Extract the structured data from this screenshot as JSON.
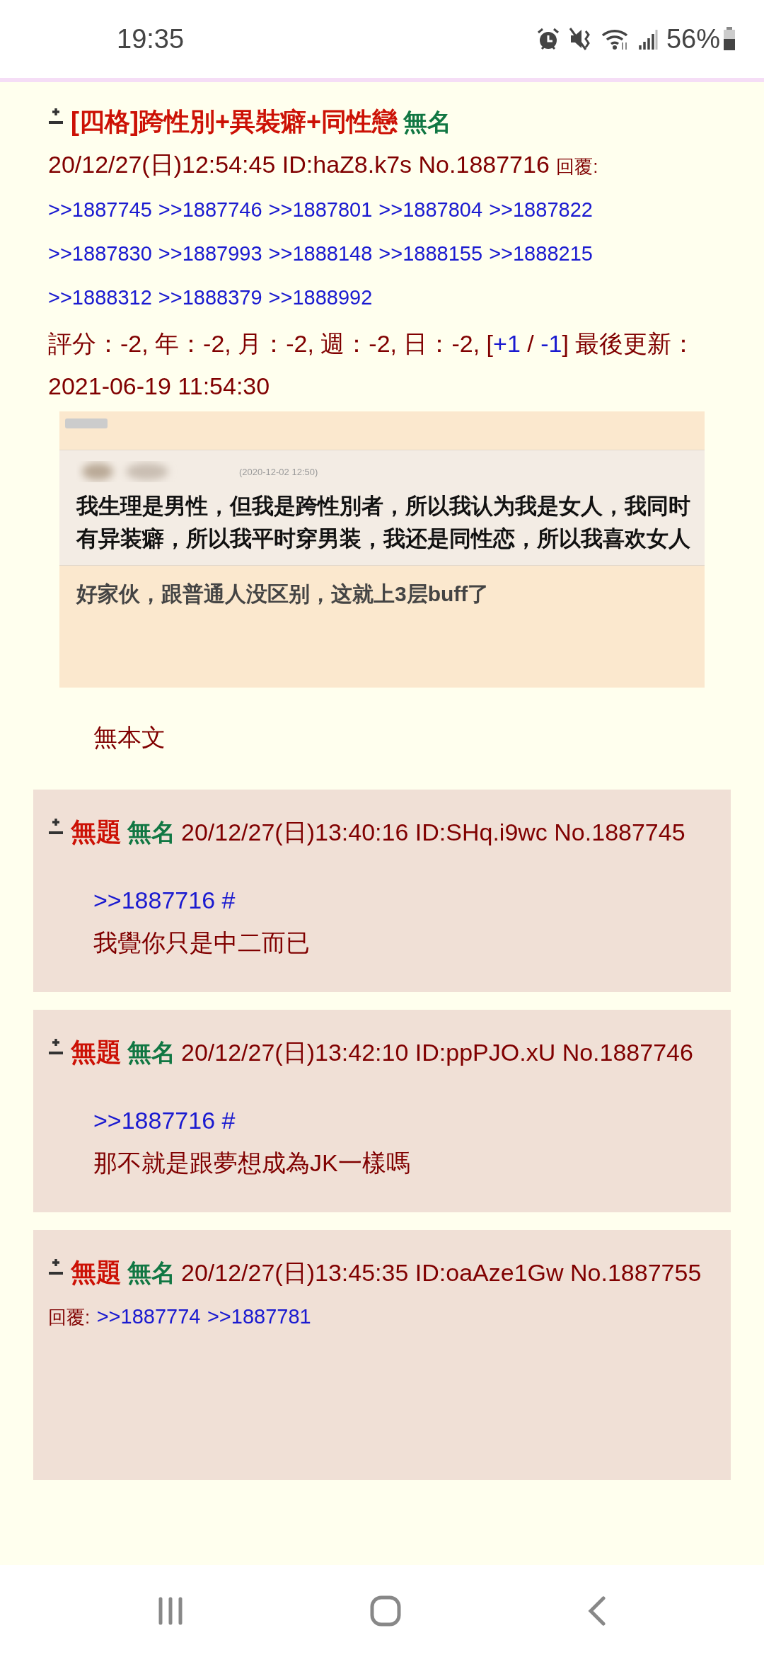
{
  "status_bar": {
    "time": "19:35",
    "battery": "56%"
  },
  "thread": {
    "title": "[四格]跨性別+異裝癖+同性戀",
    "name": "無名",
    "datetime": "20/12/27(日)12:54:45",
    "id": "ID:haZ8.k7s",
    "number": "No.1887716",
    "replies_label": "回覆:",
    "reply_links": [
      ">>1887745",
      ">>1887746",
      ">>1887801",
      ">>1887804",
      ">>1887822",
      ">>1887830",
      ">>1887993",
      ">>1888148",
      ">>1888155",
      ">>1888215",
      ">>1888312",
      ">>1888379",
      ">>1888992"
    ],
    "score": {
      "text": "評分：-2, 年：-2, 月：-2, 週：-2, 日：-2,",
      "open": "[",
      "vote_up": "+1",
      "separator": "/",
      "vote_down": "-1",
      "close": "]",
      "updated": "最後更新：2021-06-19 11:54:30"
    },
    "image": {
      "timestamp": "(2020-12-02 12:50)",
      "post_text": "我生理是男性，但我是跨性別者，所以我认为我是女人，我同时有异装癖，所以我平时穿男装，我还是同性恋，所以我喜欢女人",
      "comment": "好家伙，跟普通人没区别，这就上3层buff了"
    },
    "body": "無本文"
  },
  "replies": [
    {
      "title": "無題",
      "name": "無名",
      "datetime": "20/12/27(日)13:40:16",
      "id": "ID:SHq.i9wc",
      "number": "No.1887745",
      "quote": ">>1887716 #",
      "text": "我覺你只是中二而已"
    },
    {
      "title": "無題",
      "name": "無名",
      "datetime": "20/12/27(日)13:42:10",
      "id": "ID:ppPJO.xU",
      "number": "No.1887746",
      "quote": ">>1887716 #",
      "text": "那不就是跟夢想成為JK一樣嗎"
    },
    {
      "title": "無題",
      "name": "無名",
      "datetime": "20/12/27(日)13:45:35",
      "id": "ID:oaAze1Gw",
      "number": "No.1887755",
      "replies_label": "回覆:",
      "reply_links": [
        ">>1887774",
        ">>1887781"
      ]
    }
  ]
}
